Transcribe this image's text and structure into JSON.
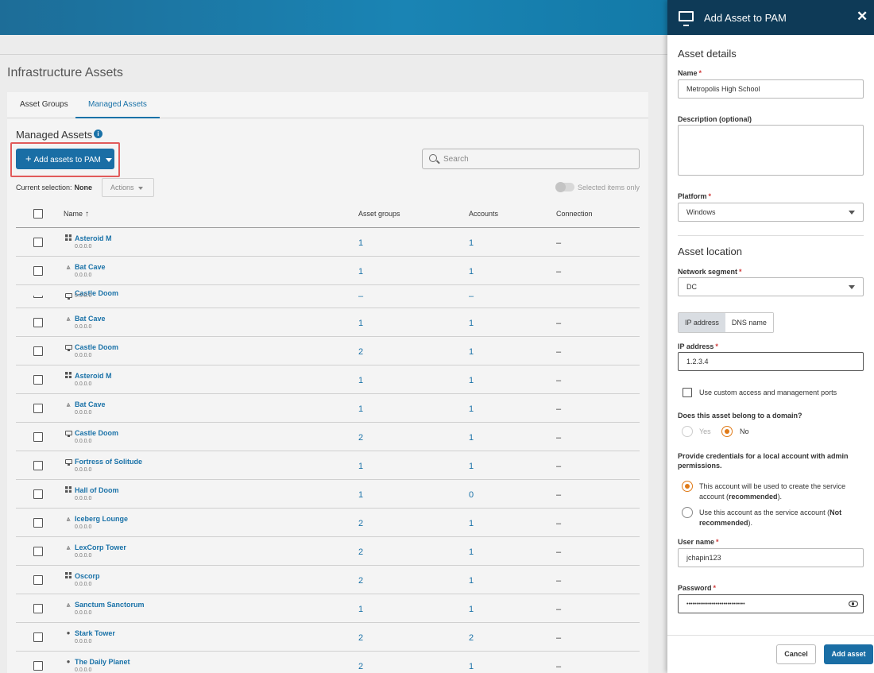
{
  "page": {
    "title": "Infrastructure Assets"
  },
  "tabs": [
    {
      "label": "Asset Groups"
    },
    {
      "label": "Managed Assets"
    }
  ],
  "main": {
    "title": "Managed Assets",
    "add_button_label": "Add assets to PAM",
    "search_placeholder": "Search",
    "selection_label": "Current selection:",
    "selection_value": "None",
    "actions_label": "Actions",
    "toggle_label": "Selected items only"
  },
  "table": {
    "columns": {
      "name": "Name",
      "asset_groups": "Asset groups",
      "accounts": "Accounts",
      "connection": "Connection"
    },
    "rows": [
      {
        "icon": "windows",
        "name": "Asteroid M",
        "ip": "0.0.0.0",
        "groups": "1",
        "accounts": "1",
        "connection": "–"
      },
      {
        "icon": "linux",
        "name": "Bat Cave",
        "ip": "0.0.0.0",
        "groups": "1",
        "accounts": "1",
        "connection": "–"
      },
      {
        "icon": "monitor",
        "name": "Castle Doom",
        "ip": "0.0.0.0",
        "groups": "–",
        "accounts": "–",
        "connection": ""
      },
      {
        "icon": "linux",
        "name": "Bat Cave",
        "ip": "0.0.0.0",
        "groups": "1",
        "accounts": "1",
        "connection": "–"
      },
      {
        "icon": "monitor",
        "name": "Castle Doom",
        "ip": "0.0.0.0",
        "groups": "2",
        "accounts": "1",
        "connection": "–"
      },
      {
        "icon": "windows",
        "name": "Asteroid M",
        "ip": "0.0.0.0",
        "groups": "1",
        "accounts": "1",
        "connection": "–"
      },
      {
        "icon": "linux",
        "name": "Bat Cave",
        "ip": "0.0.0.0",
        "groups": "1",
        "accounts": "1",
        "connection": "–"
      },
      {
        "icon": "monitor",
        "name": "Castle Doom",
        "ip": "0.0.0.0",
        "groups": "2",
        "accounts": "1",
        "connection": "–"
      },
      {
        "icon": "monitor",
        "name": "Fortress of Solitude",
        "ip": "0.0.0.0",
        "groups": "1",
        "accounts": "1",
        "connection": "–"
      },
      {
        "icon": "windows",
        "name": "Hall of Doom",
        "ip": "0.0.0.0",
        "groups": "1",
        "accounts": "0",
        "connection": "–"
      },
      {
        "icon": "linux",
        "name": "Iceberg Lounge",
        "ip": "0.0.0.0",
        "groups": "2",
        "accounts": "1",
        "connection": "–"
      },
      {
        "icon": "linux",
        "name": "LexCorp Tower",
        "ip": "0.0.0.0",
        "groups": "2",
        "accounts": "1",
        "connection": "–"
      },
      {
        "icon": "windows",
        "name": "Oscorp",
        "ip": "0.0.0.0",
        "groups": "2",
        "accounts": "1",
        "connection": "–"
      },
      {
        "icon": "linux",
        "name": "Sanctum Sanctorum",
        "ip": "0.0.0.0",
        "groups": "1",
        "accounts": "1",
        "connection": "–"
      },
      {
        "icon": "apple",
        "name": "Stark Tower",
        "ip": "0.0.0.0",
        "groups": "2",
        "accounts": "2",
        "connection": "–"
      },
      {
        "icon": "apple",
        "name": "The Daily Planet",
        "ip": "0.0.0.0",
        "groups": "2",
        "accounts": "1",
        "connection": "–"
      }
    ]
  },
  "panel": {
    "title": "Add Asset to PAM",
    "asset_details_title": "Asset details",
    "name_label": "Name",
    "name_value": "Metropolis High School",
    "description_label": "Description (optional)",
    "platform_label": "Platform",
    "platform_value": "Windows",
    "asset_location_title": "Asset location",
    "network_segment_label": "Network segment",
    "network_segment_value": "DC",
    "seg_ip": "IP address",
    "seg_dns": "DNS name",
    "ip_label": "IP address",
    "ip_value": "1.2.3.4",
    "custom_ports_label": "Use custom access and management ports",
    "domain_question": "Does this asset belong to a domain?",
    "domain_yes": "Yes",
    "domain_no": "No",
    "credentials_question": "Provide credentials for a local account with admin permissions.",
    "cred_opt1_a": "This account will be used to create the service account (",
    "cred_opt1_b": "recommended",
    "cred_opt1_c": ").",
    "cred_opt2_a": "Use this account as the service account (",
    "cred_opt2_b": "Not recommended",
    "cred_opt2_c": ").",
    "username_label": "User name",
    "username_value": "jchapin123",
    "password_label": "Password",
    "password_value": "••••••••••••••••••••••••••••••",
    "cancel_label": "Cancel",
    "add_label": "Add asset"
  },
  "colors": {
    "accent": "#1a6ea5",
    "header_dark": "#0e3a57",
    "required": "#d03a3a",
    "radio_checked": "#e07a17",
    "highlight_outline": "#e15b5b"
  }
}
